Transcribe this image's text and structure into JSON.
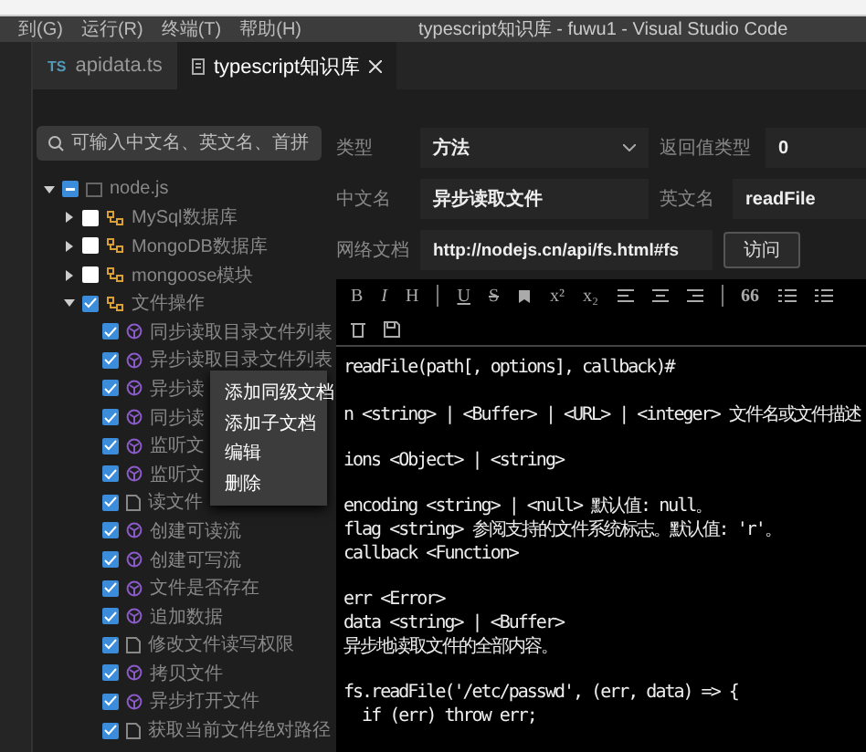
{
  "menu_bar": [
    "到(G)",
    "运行(R)",
    "终端(T)",
    "帮助(H)"
  ],
  "window": {
    "title": "typescript知识库 - fuwu1 - Visual Studio Code"
  },
  "tabs": [
    {
      "label": "apidata.ts",
      "icon_text": "TS",
      "selected": false
    },
    {
      "label": "typescript知识库",
      "selected": true
    }
  ],
  "search": {
    "placeholder": "可输入中文名、英文名、首拼"
  },
  "tree": [
    {
      "label": "node.js",
      "kind": "root",
      "indeterminate": true,
      "expanded": true,
      "children": [
        {
          "label": "MySql数据库",
          "kind": "folder",
          "checked": false,
          "expanded": false
        },
        {
          "label": "MongoDB数据库",
          "kind": "folder",
          "checked": false,
          "expanded": false
        },
        {
          "label": "mongoose模块",
          "kind": "folder",
          "checked": false,
          "expanded": false
        },
        {
          "label": "文件操作",
          "kind": "folder",
          "checked": true,
          "expanded": true,
          "children": [
            {
              "label": "同步读取目录文件列表",
              "kind": "method",
              "checked": true
            },
            {
              "label": "异步读取目录文件列表",
              "kind": "method",
              "checked": true
            },
            {
              "label": "异步读",
              "kind": "method",
              "checked": true
            },
            {
              "label": "同步读",
              "kind": "method",
              "checked": true
            },
            {
              "label": "监听文",
              "kind": "method",
              "checked": true
            },
            {
              "label": "监听文",
              "kind": "method",
              "checked": true
            },
            {
              "label": "读文件",
              "kind": "doc",
              "checked": true
            },
            {
              "label": "创建可读流",
              "kind": "method",
              "checked": true
            },
            {
              "label": "创建可写流",
              "kind": "method",
              "checked": true
            },
            {
              "label": "文件是否存在",
              "kind": "method",
              "checked": true
            },
            {
              "label": "追加数据",
              "kind": "method",
              "checked": true
            },
            {
              "label": "修改文件读写权限",
              "kind": "doc",
              "checked": true
            },
            {
              "label": "拷贝文件",
              "kind": "method",
              "checked": true
            },
            {
              "label": "异步打开文件",
              "kind": "method",
              "checked": true
            },
            {
              "label": "获取当前文件绝对路径",
              "kind": "doc",
              "checked": true
            }
          ]
        }
      ]
    }
  ],
  "context_menu": [
    "添加同级文档",
    "添加子文档",
    "编辑",
    "删除"
  ],
  "form": {
    "type_label": "类型",
    "type_value": "方法",
    "return_label": "返回值类型",
    "return_value": "0",
    "cn_label": "中文名",
    "cn_value": "异步读取文件",
    "en_label": "英文名",
    "en_value": "readFile",
    "doc_label": "网络文档",
    "doc_value": "http://nodejs.cn/api/fs.html#fs",
    "visit_button": "访问"
  },
  "toolbar": [
    [
      {
        "kind": "text",
        "label": "B"
      },
      {
        "kind": "text",
        "label": "I"
      },
      {
        "kind": "text",
        "label": "H"
      },
      {
        "kind": "separator"
      },
      {
        "kind": "text",
        "label": "U"
      },
      {
        "kind": "text",
        "label": "S"
      },
      {
        "kind": "bookmark"
      },
      {
        "kind": "text",
        "label": "x²"
      },
      {
        "kind": "text",
        "label": "x₂"
      },
      {
        "kind": "align_left"
      },
      {
        "kind": "align_center"
      },
      {
        "kind": "align_right"
      },
      {
        "kind": "separator"
      },
      {
        "kind": "text",
        "label": "66"
      },
      {
        "kind": "numbered_list"
      },
      {
        "kind": "bullet_list"
      }
    ],
    [
      {
        "kind": "trash"
      },
      {
        "kind": "save"
      }
    ]
  ],
  "code_blocks": [
    [
      "readFile(path[, options], callback)#"
    ],
    [
      "n <string> | <Buffer> | <URL> | <integer> 文件名或文件描述"
    ],
    [
      "ions <Object> | <string>"
    ],
    [
      "encoding <string> | <null> 默认值: null。",
      "flag <string> 参阅支持的文件系统标志。默认值: 'r'。",
      "callback <Function>"
    ],
    [
      "err <Error>",
      "data <string> | <Buffer>",
      "异步地读取文件的全部内容。"
    ],
    [
      "fs.readFile('/etc/passwd', (err, data) => {",
      "  if (err) throw err;"
    ]
  ]
}
